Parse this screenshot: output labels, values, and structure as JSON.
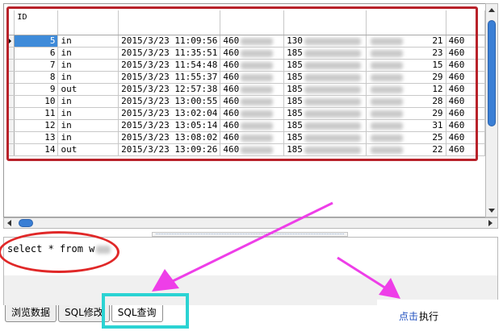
{
  "grid": {
    "columns": [
      "ID",
      "",
      "",
      "",
      "",
      "",
      ""
    ],
    "rows": [
      {
        "id": "5",
        "dir": "in",
        "time": "2015/3/23 11:09:56",
        "code": "460",
        "phone": "130",
        "n": "21",
        "last": "460",
        "current": true
      },
      {
        "id": "6",
        "dir": "in",
        "time": "2015/3/23 11:35:51",
        "code": "460",
        "phone": "185",
        "n": "23",
        "last": "460",
        "current": false
      },
      {
        "id": "7",
        "dir": "in",
        "time": "2015/3/23 11:54:48",
        "code": "460",
        "phone": "185",
        "n": "15",
        "last": "460",
        "current": false
      },
      {
        "id": "8",
        "dir": "in",
        "time": "2015/3/23 11:55:37",
        "code": "460",
        "phone": "185",
        "n": "29",
        "last": "460",
        "current": false
      },
      {
        "id": "9",
        "dir": "out",
        "time": "2015/3/23 12:57:38",
        "code": "460",
        "phone": "185",
        "n": "12",
        "last": "460",
        "current": false
      },
      {
        "id": "10",
        "dir": "in",
        "time": "2015/3/23 13:00:55",
        "code": "460",
        "phone": "185",
        "n": "28",
        "last": "460",
        "current": false
      },
      {
        "id": "11",
        "dir": "in",
        "time": "2015/3/23 13:02:04",
        "code": "460",
        "phone": "185",
        "n": "29",
        "last": "460",
        "current": false
      },
      {
        "id": "12",
        "dir": "in",
        "time": "2015/3/23 13:05:14",
        "code": "460",
        "phone": "185",
        "n": "31",
        "last": "460",
        "current": false
      },
      {
        "id": "13",
        "dir": "in",
        "time": "2015/3/23 13:08:02",
        "code": "460",
        "phone": "185",
        "n": "25",
        "last": "460",
        "current": false
      },
      {
        "id": "14",
        "dir": "out",
        "time": "2015/3/23 13:09:26",
        "code": "460",
        "phone": "185",
        "n": "22",
        "last": "460",
        "current": false
      }
    ]
  },
  "editor": {
    "sql": "select * from w"
  },
  "tabs": [
    {
      "label": "浏览数据",
      "active": false
    },
    {
      "label": "SQL修改",
      "active": false
    },
    {
      "label": "SQL查询",
      "active": true
    }
  ],
  "execute": {
    "hint": "点击",
    "label": "执行"
  },
  "colors": {
    "grid_highlight": "#b8222a",
    "ellipse": "#e02828",
    "tab_highlight": "#2bd3d3",
    "arrow": "#ee3ee8",
    "selection": "#3f8bd9",
    "scroll_thumb": "#3a7fd5",
    "hint_text": "#1f4fbf"
  }
}
